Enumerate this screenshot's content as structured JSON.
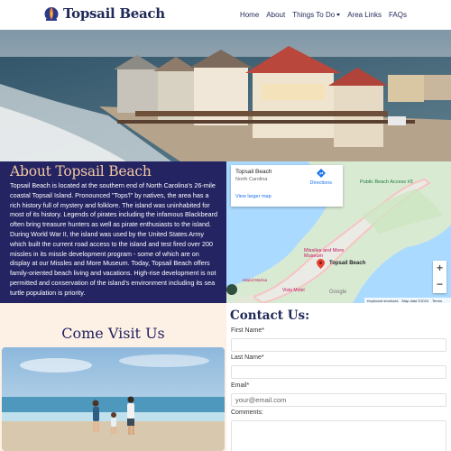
{
  "header": {
    "site_title": "Topsail Beach",
    "nav": [
      {
        "label": "Home"
      },
      {
        "label": "About"
      },
      {
        "label": "Things To Do"
      },
      {
        "label": "Area Links"
      },
      {
        "label": "FAQs"
      }
    ]
  },
  "about": {
    "title": "About Topsail Beach",
    "body": "Topsail Beach is located at the southern end of North Carolina's 26-mile coastal Topsail Island. Pronounced \"Tops'l\" by natives, the area has a rich history full of mystery and folklore. The island was uninhabited for most of its history. Legends of pirates including the infamous Blackbeard often bring treasure hunters as well as pirate enthusiasts to the island. During World War II, the island was used by the United States Army which built the current road access to the island and test fired over 200 missles in its missle development program - some of which are on display at our Missles and More Museum. Today, Topsail Beach offers family-oriented beach living and vacations. High-rise development is not permitted and conservation of the island's environment including its sea turtle population is priority."
  },
  "map": {
    "card_title": "Topsail Beach",
    "card_subtitle": "North Carolina",
    "directions_label": "Directions",
    "larger_map_link": "View larger map",
    "labels": {
      "public_beach": "Public Beach Access #3",
      "museum_line1": "Missiles and More",
      "museum_line2": "Museum",
      "town": "Topsail Beach",
      "south": "Topsail Island Beach",
      "partial": "Island Marina",
      "vista": "Vista Motel",
      "google": "Google"
    },
    "zoom_in": "+",
    "zoom_out": "−",
    "footer": [
      "Keyboard shortcuts",
      "Map data ©2024",
      "Terms"
    ]
  },
  "visit": {
    "title": "Come Visit Us"
  },
  "contact": {
    "title": "Contact Us:",
    "first_name_label": "First Name*",
    "last_name_label": "Last Name*",
    "email_label": "Email*",
    "email_placeholder": "your@email.com",
    "comments_label": "Comments:"
  },
  "colors": {
    "navy": "#242463",
    "peach": "#f3c9a3",
    "cream": "#fdf0e4"
  }
}
